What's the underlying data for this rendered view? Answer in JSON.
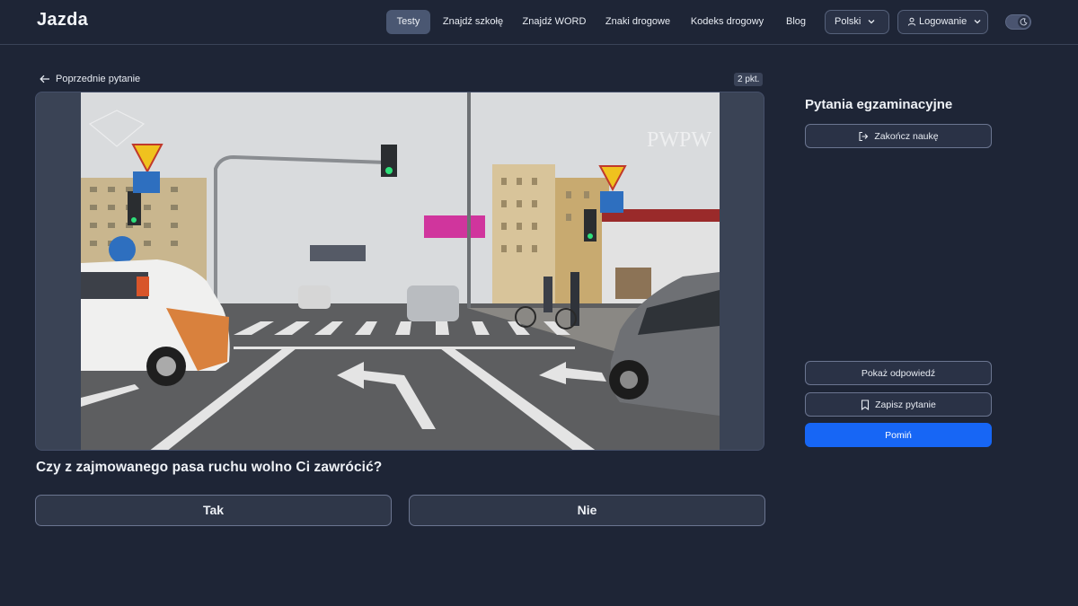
{
  "brand": {
    "logo": "Jazda"
  },
  "nav": {
    "items": [
      {
        "label": "Testy",
        "active": true
      },
      {
        "label": "Znajdź szkołę",
        "active": false
      },
      {
        "label": "Znajdź WORD",
        "active": false
      },
      {
        "label": "Znaki drogowe",
        "active": false
      },
      {
        "label": "Kodeks drogowy",
        "active": false
      },
      {
        "label": "Blog",
        "active": false
      }
    ],
    "language": "Polski",
    "login": "Logowanie",
    "theme_toggle_icon": "moon-icon"
  },
  "question": {
    "back_label": "Poprzednie pytanie",
    "points": "2 pkt.",
    "text": "Czy z zajmowanego pasa ruchu wolno Ci zawrócić?",
    "answers": [
      "Tak",
      "Nie"
    ],
    "image_watermark": "PWPW"
  },
  "sidebar": {
    "title": "Pytania egzaminacyjne",
    "finish_label": "Zakończ naukę",
    "show_answer_label": "Pokaż odpowiedź",
    "save_label": "Zapisz pytanie",
    "skip_label": "Pomiń"
  },
  "colors": {
    "background": "#1e2536",
    "accent": "#1766f5",
    "active_nav": "#4a5772"
  }
}
